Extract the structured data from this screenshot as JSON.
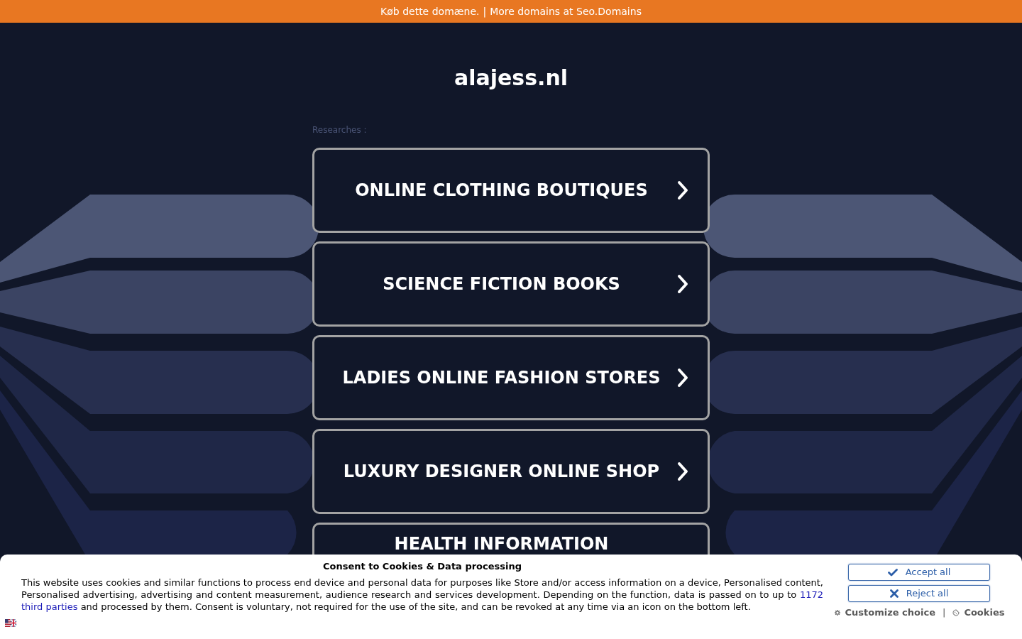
{
  "top_bar": {
    "links": [
      "Køb dette domæne.",
      "More domains at Seo.Domains"
    ],
    "separator": "|"
  },
  "site_title": "alajess.nl",
  "researches_label": "Researches :",
  "research_links": [
    {
      "label": "ONLINE CLOTHING BOUTIQUES"
    },
    {
      "label": "SCIENCE FICTION BOOKS"
    },
    {
      "label": "LADIES ONLINE FASHION STORES"
    },
    {
      "label": "LUXURY DESIGNER ONLINE SHOP"
    },
    {
      "label": "HEALTH INFORMATION"
    }
  ],
  "consent": {
    "title": "Consent to Cookies & Data processing",
    "text_parts": [
      {
        "kind": "text",
        "text": "This website uses cookies and similar functions to process end device and personal data for purposes like Store and/or access information on a device, Personalised content, Personalised advertising, advertising and content measurement, audience research and services development. Depending on the function, data is passed on to up to"
      },
      {
        "kind": "link",
        "text": "1172"
      },
      {
        "kind": "link",
        "text": "third parties"
      },
      {
        "kind": "text",
        "text": "and processed by them. Consent is voluntary, not required for the use of the site, and can be revoked at any time via an icon on the bottom left."
      }
    ],
    "buttons": [
      {
        "kind": "accept",
        "label": "Accept all"
      },
      {
        "kind": "reject",
        "label": "Reject all"
      }
    ],
    "links": [
      {
        "kind": "customize",
        "label": "Customize choice"
      },
      {
        "kind": "cookies",
        "label": "Cookies"
      }
    ],
    "links_separator": "|"
  }
}
